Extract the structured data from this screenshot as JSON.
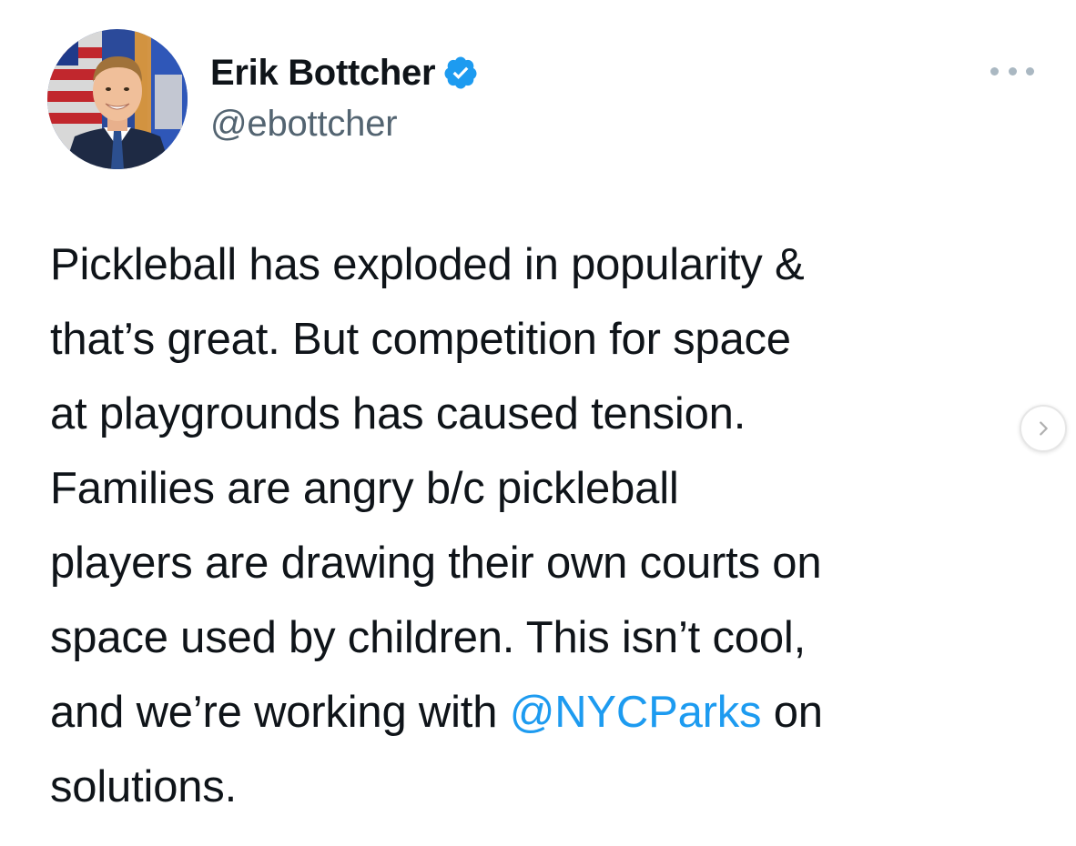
{
  "author": {
    "display_name": "Erik Bottcher",
    "handle": "@ebottcher",
    "verified": true,
    "verified_color": "#1d9bf0"
  },
  "icons": {
    "avatar": "profile-photo",
    "verified": "verified-badge-icon",
    "more": "more-options-icon",
    "next": "chevron-right-icon"
  },
  "tweet": {
    "lines": [
      "Pickleball has exploded in popularity &",
      "that’s great. But competition for space",
      "at playgrounds has caused tension.",
      "Families are angry b/c pickleball",
      "players are drawing their own courts on",
      "space used by children. This isn’t cool,",
      "and we’re working with ",
      "solutions."
    ],
    "mention": "@NYCParks",
    "after_mention": " on",
    "mention_color": "#1d9bf0"
  }
}
